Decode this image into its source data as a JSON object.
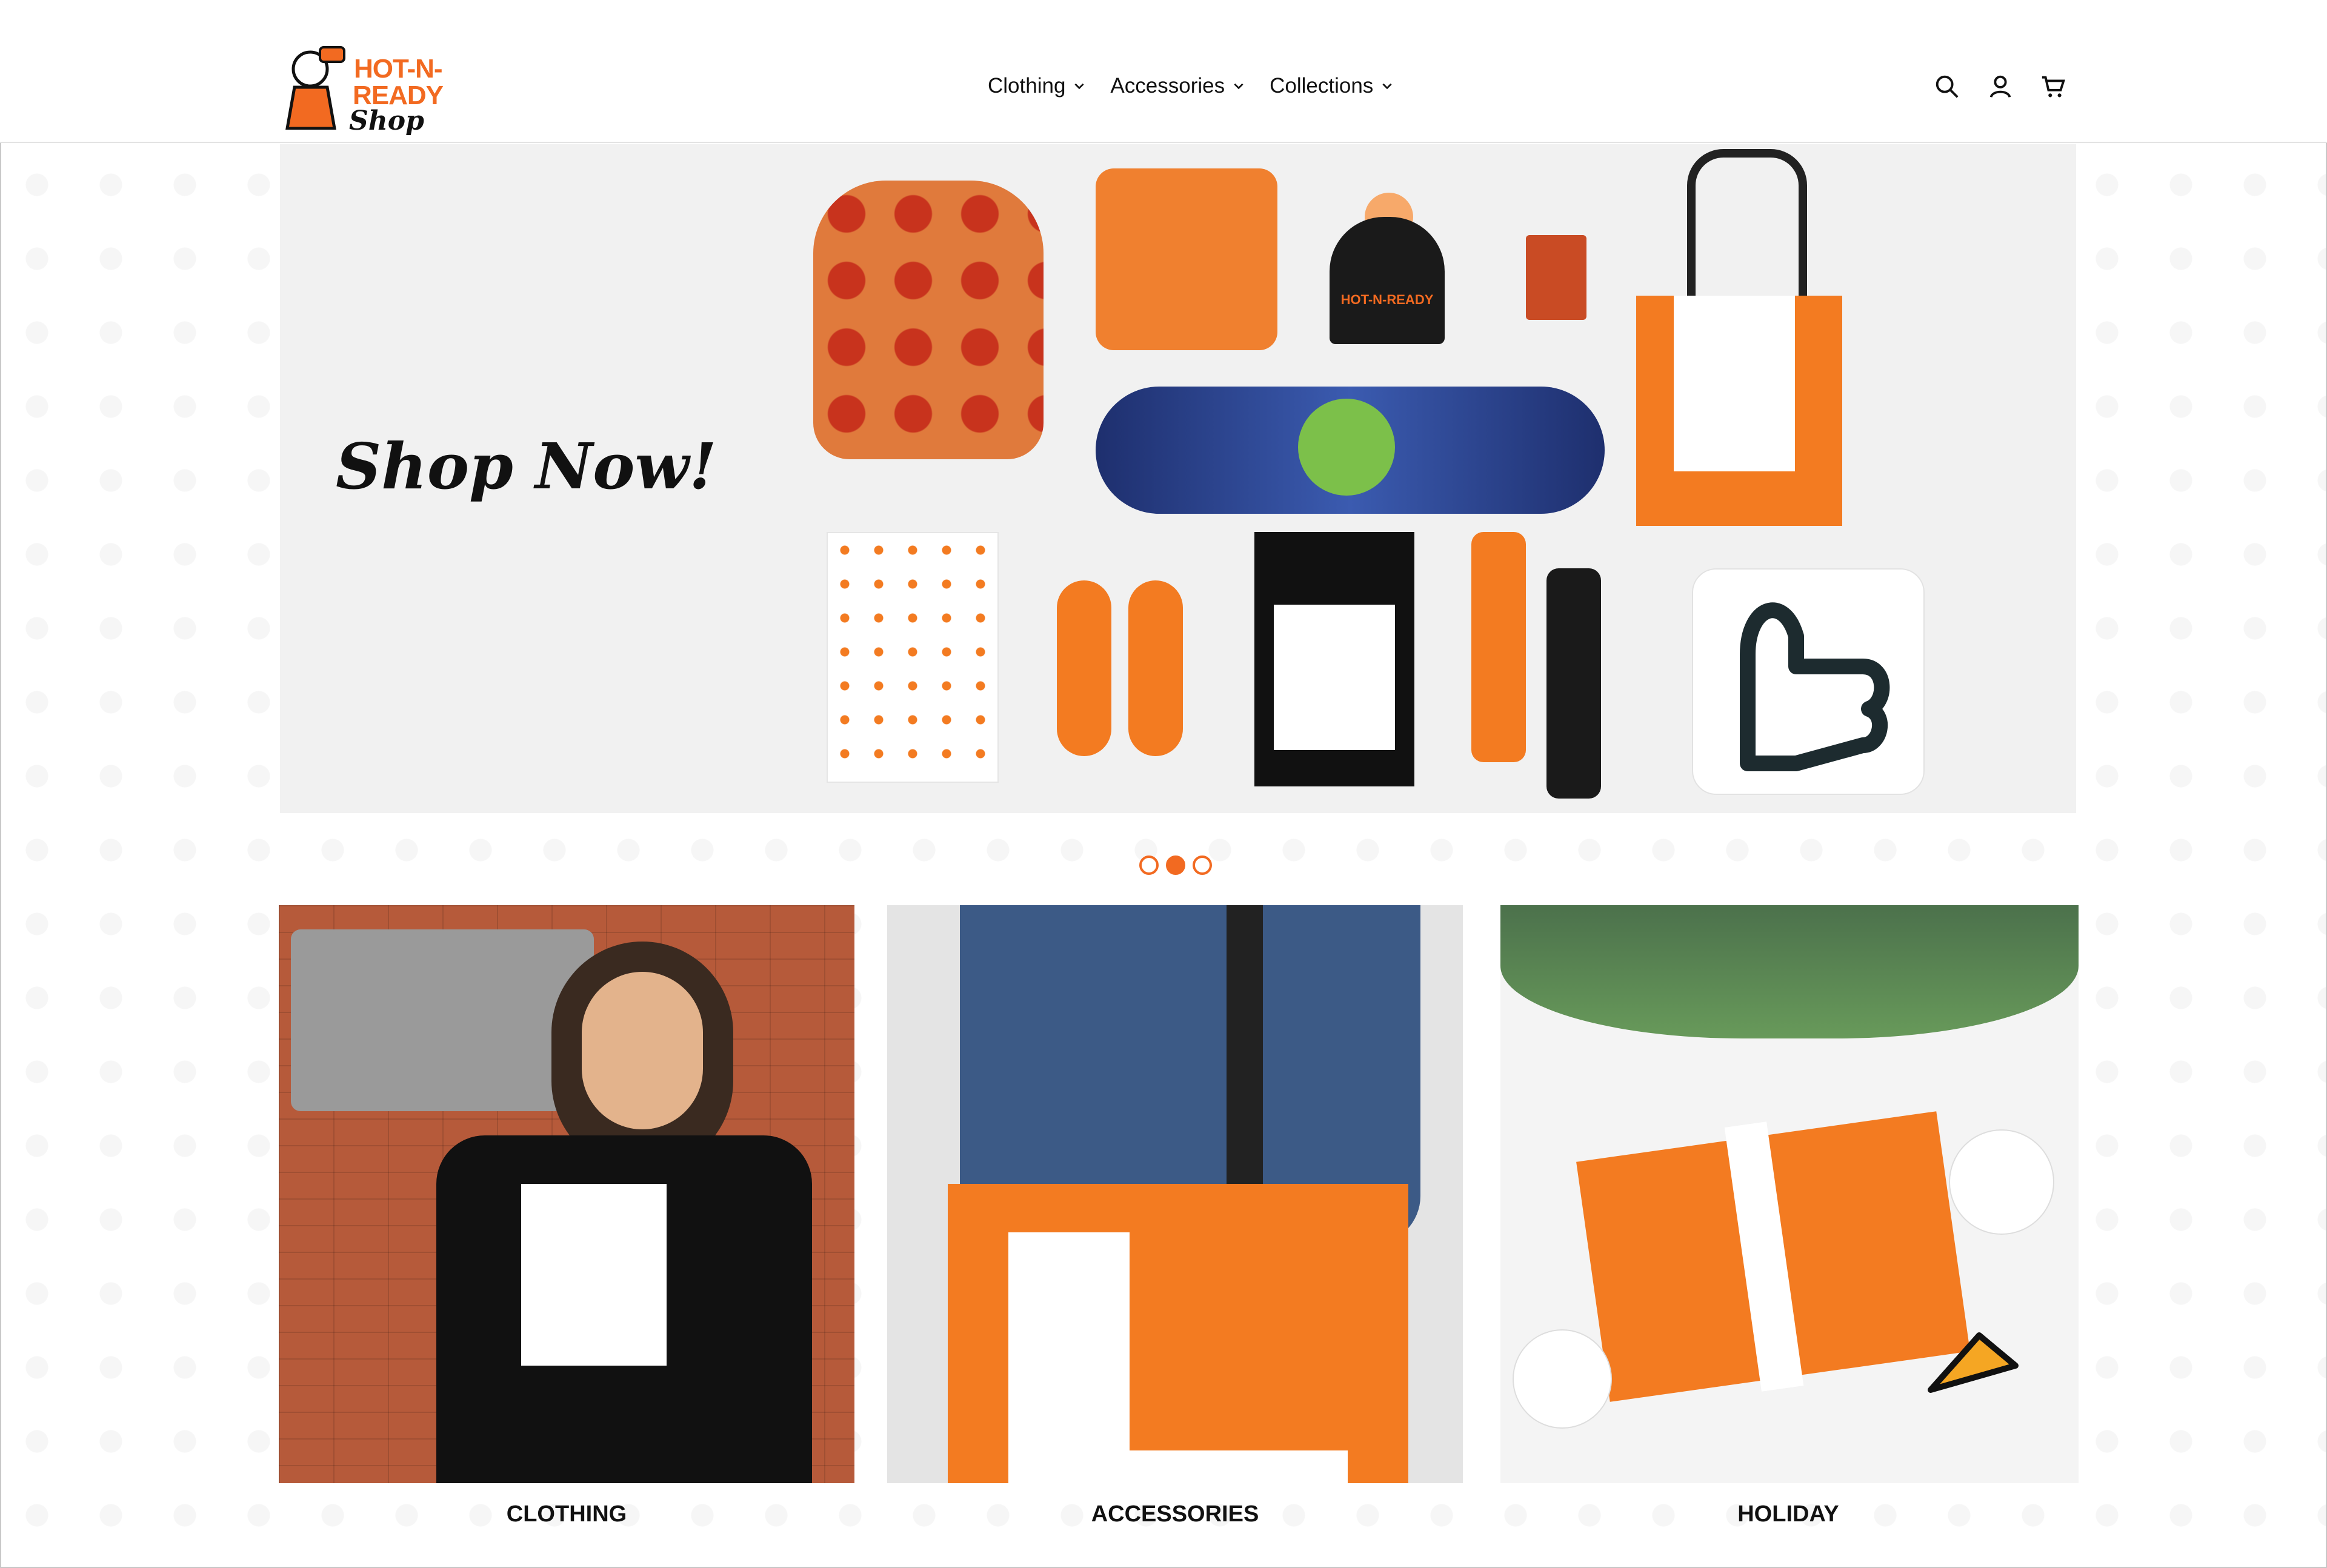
{
  "brand": {
    "logo_line1": "HOT-N-",
    "logo_line2": "READY",
    "logo_line3": "Shop",
    "accent_color": "#f26a21"
  },
  "nav": {
    "items": [
      {
        "label": "Clothing",
        "icon": "chevron-down-icon"
      },
      {
        "label": "Accessories",
        "icon": "chevron-down-icon"
      },
      {
        "label": "Collections",
        "icon": "chevron-down-icon"
      }
    ]
  },
  "header_icons": [
    "search-icon",
    "account-icon",
    "cart-icon"
  ],
  "hero": {
    "headline": "Shop Now!",
    "beanie_text": "HOT-N-READY"
  },
  "carousel": {
    "slides": 3,
    "active_index": 1
  },
  "categories": [
    {
      "label": "CLOTHING"
    },
    {
      "label": "ACCESSORIES"
    },
    {
      "label": "HOLIDAY"
    }
  ]
}
